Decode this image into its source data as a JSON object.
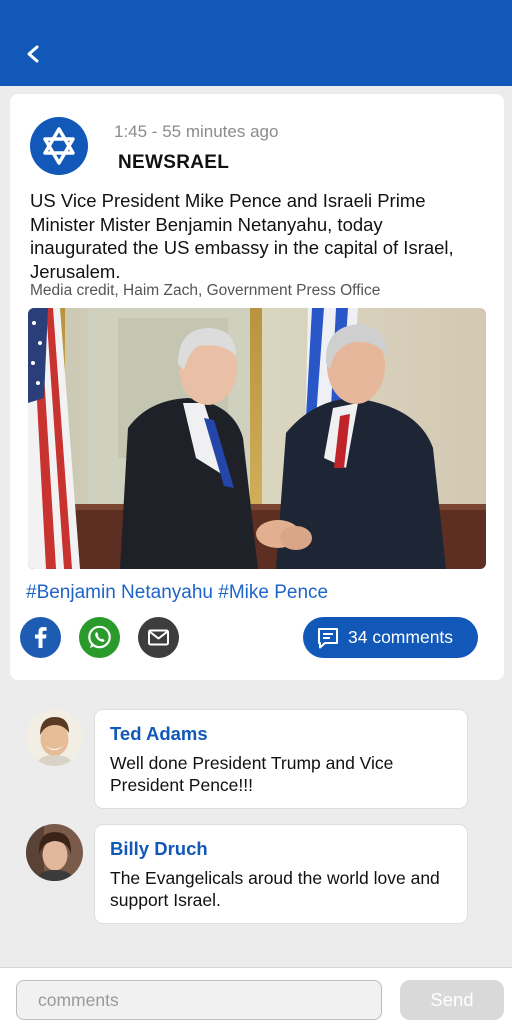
{
  "header": {
    "back_icon": "chevron-left-icon",
    "background": "#1158b8"
  },
  "post": {
    "logo_icon": "star-of-david-icon",
    "time": "1:45 - 55 minutes ago",
    "source": "NEWSRAEL",
    "headline": "US Vice President Mike Pence and Israeli Prime Minister Mister Benjamin Netanyahu, today inaugurated the US embassy in the capital of Israel, Jerusalem.",
    "credit": "Media credit, Haim Zach, Government Press Office",
    "photo_subject": "two-men-handshake-photo",
    "hashtags": [
      "#Benjamin Netanyahu",
      "#Mike Pence"
    ],
    "share": [
      {
        "name": "facebook-icon",
        "color": "#1e5cb3"
      },
      {
        "name": "whatsapp-icon",
        "color": "#2a9a2a"
      },
      {
        "name": "mail-icon",
        "color": "#3d3d3d"
      }
    ],
    "comments_label": "34 comments",
    "accent": "#1158b8"
  },
  "comments": [
    {
      "author": "Ted Adams",
      "text": "Well done President Trump and Vice President Pence!!!"
    },
    {
      "author": "Billy Druch",
      "text": "The Evangelicals aroud the world love and support Israel."
    }
  ],
  "composer": {
    "placeholder": "comments",
    "send_label": "Send"
  }
}
